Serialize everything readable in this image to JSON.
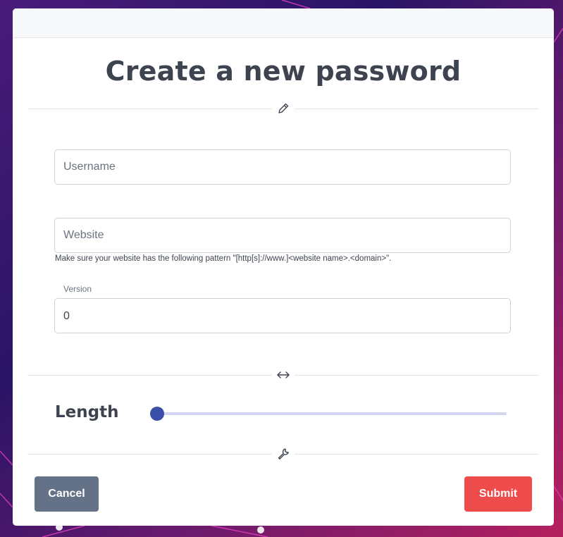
{
  "form": {
    "title": "Create a new password",
    "username": {
      "placeholder": "Username",
      "value": ""
    },
    "website": {
      "placeholder": "Website",
      "value": "",
      "hint": "Make sure your website has the following pattern \"[http[s]://www.]<website name>.<domain>\"."
    },
    "version": {
      "label": "Version",
      "value": "0"
    },
    "length": {
      "label": "Length",
      "value_fraction": 0
    },
    "buttons": {
      "cancel": "Cancel",
      "submit": "Submit"
    }
  },
  "icons": {
    "section1": "pencil-icon",
    "section2": "arrows-left-right-icon",
    "section3": "wrench-icon"
  },
  "colors": {
    "primary_slider": "#3c4fa8",
    "cancel_button": "#637286",
    "submit_button": "#ee4b4b",
    "text": "#3d4450"
  }
}
